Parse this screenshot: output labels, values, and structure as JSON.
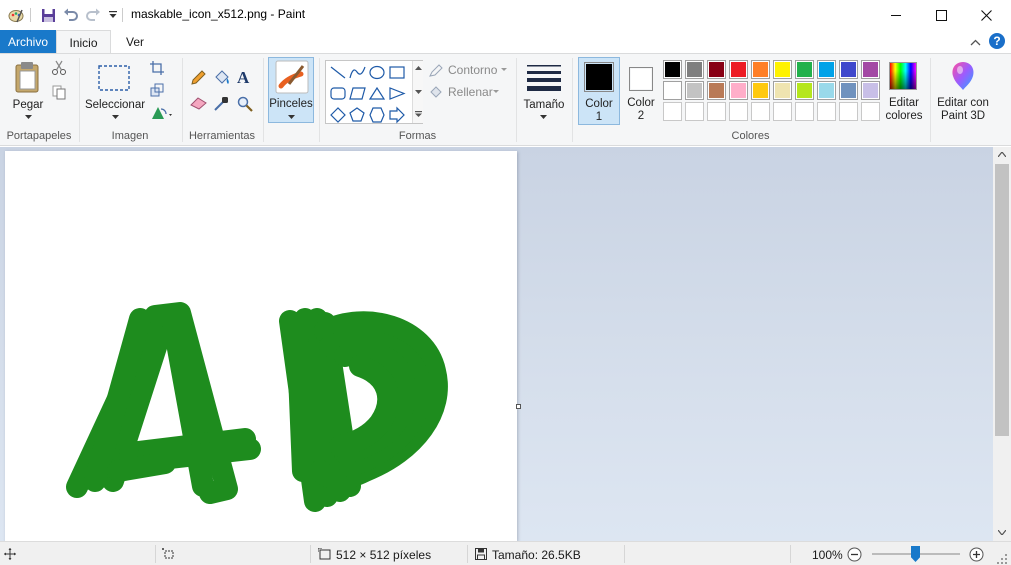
{
  "window": {
    "title": "maskable_icon_x512.png - Paint"
  },
  "tabs": {
    "file": "Archivo",
    "home": "Inicio",
    "view": "Ver"
  },
  "ribbon": {
    "clipboard": {
      "paste": "Pegar",
      "group": "Portapapeles"
    },
    "image": {
      "select": "Seleccionar",
      "group": "Imagen"
    },
    "tools": {
      "group": "Herramientas"
    },
    "brushes": {
      "label": "Pinceles"
    },
    "shapes": {
      "outline": "Contorno",
      "fill": "Rellenar",
      "group": "Formas"
    },
    "size": {
      "label": "Tamaño"
    },
    "colors": {
      "color1_line1": "Color",
      "color1_line2": "1",
      "color2_line1": "Color",
      "color2_line2": "2",
      "edit_line1": "Editar",
      "edit_line2": "colores",
      "group": "Colores",
      "color1_value": "#000000",
      "color2_value": "#ffffff",
      "palette_row1": [
        "#000000",
        "#7f7f7f",
        "#880015",
        "#ed1c24",
        "#ff7f27",
        "#fff200",
        "#22b14c",
        "#00a2e8",
        "#3f48cc",
        "#a349a4"
      ],
      "palette_row2": [
        "#ffffff",
        "#c3c3c3",
        "#b97a57",
        "#ffaec9",
        "#ffc90e",
        "#efe4b0",
        "#b5e61d",
        "#99d9ea",
        "#7092be",
        "#c8bfe7"
      ]
    },
    "paint3d": {
      "line1": "Editar con",
      "line2": "Paint 3D"
    }
  },
  "canvas": {
    "drawing_text": "AD",
    "stroke_color": "#1e8c1e"
  },
  "status": {
    "dimensions": "512 × 512 píxeles",
    "size": "Tamaño: 26.5KB",
    "zoom": "100%"
  }
}
